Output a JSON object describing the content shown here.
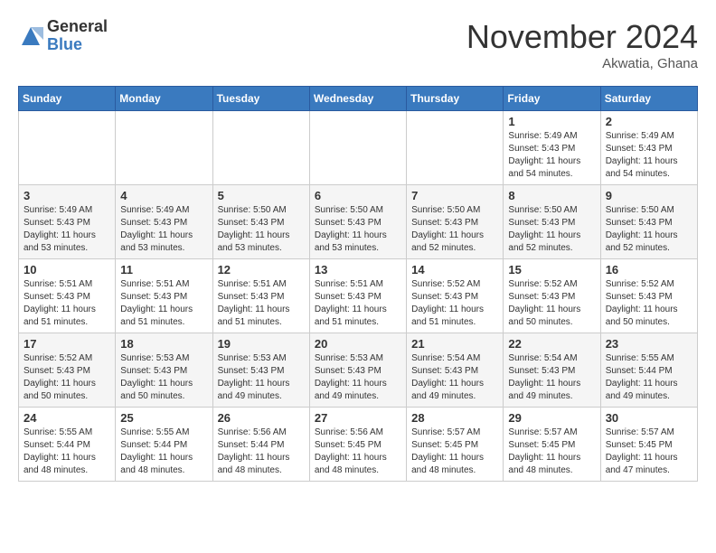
{
  "header": {
    "logo_general": "General",
    "logo_blue": "Blue",
    "month_title": "November 2024",
    "location": "Akwatia, Ghana"
  },
  "weekdays": [
    "Sunday",
    "Monday",
    "Tuesday",
    "Wednesday",
    "Thursday",
    "Friday",
    "Saturday"
  ],
  "weeks": [
    [
      {
        "day": "",
        "info": ""
      },
      {
        "day": "",
        "info": ""
      },
      {
        "day": "",
        "info": ""
      },
      {
        "day": "",
        "info": ""
      },
      {
        "day": "",
        "info": ""
      },
      {
        "day": "1",
        "info": "Sunrise: 5:49 AM\nSunset: 5:43 PM\nDaylight: 11 hours\nand 54 minutes."
      },
      {
        "day": "2",
        "info": "Sunrise: 5:49 AM\nSunset: 5:43 PM\nDaylight: 11 hours\nand 54 minutes."
      }
    ],
    [
      {
        "day": "3",
        "info": "Sunrise: 5:49 AM\nSunset: 5:43 PM\nDaylight: 11 hours\nand 53 minutes."
      },
      {
        "day": "4",
        "info": "Sunrise: 5:49 AM\nSunset: 5:43 PM\nDaylight: 11 hours\nand 53 minutes."
      },
      {
        "day": "5",
        "info": "Sunrise: 5:50 AM\nSunset: 5:43 PM\nDaylight: 11 hours\nand 53 minutes."
      },
      {
        "day": "6",
        "info": "Sunrise: 5:50 AM\nSunset: 5:43 PM\nDaylight: 11 hours\nand 53 minutes."
      },
      {
        "day": "7",
        "info": "Sunrise: 5:50 AM\nSunset: 5:43 PM\nDaylight: 11 hours\nand 52 minutes."
      },
      {
        "day": "8",
        "info": "Sunrise: 5:50 AM\nSunset: 5:43 PM\nDaylight: 11 hours\nand 52 minutes."
      },
      {
        "day": "9",
        "info": "Sunrise: 5:50 AM\nSunset: 5:43 PM\nDaylight: 11 hours\nand 52 minutes."
      }
    ],
    [
      {
        "day": "10",
        "info": "Sunrise: 5:51 AM\nSunset: 5:43 PM\nDaylight: 11 hours\nand 51 minutes."
      },
      {
        "day": "11",
        "info": "Sunrise: 5:51 AM\nSunset: 5:43 PM\nDaylight: 11 hours\nand 51 minutes."
      },
      {
        "day": "12",
        "info": "Sunrise: 5:51 AM\nSunset: 5:43 PM\nDaylight: 11 hours\nand 51 minutes."
      },
      {
        "day": "13",
        "info": "Sunrise: 5:51 AM\nSunset: 5:43 PM\nDaylight: 11 hours\nand 51 minutes."
      },
      {
        "day": "14",
        "info": "Sunrise: 5:52 AM\nSunset: 5:43 PM\nDaylight: 11 hours\nand 51 minutes."
      },
      {
        "day": "15",
        "info": "Sunrise: 5:52 AM\nSunset: 5:43 PM\nDaylight: 11 hours\nand 50 minutes."
      },
      {
        "day": "16",
        "info": "Sunrise: 5:52 AM\nSunset: 5:43 PM\nDaylight: 11 hours\nand 50 minutes."
      }
    ],
    [
      {
        "day": "17",
        "info": "Sunrise: 5:52 AM\nSunset: 5:43 PM\nDaylight: 11 hours\nand 50 minutes."
      },
      {
        "day": "18",
        "info": "Sunrise: 5:53 AM\nSunset: 5:43 PM\nDaylight: 11 hours\nand 50 minutes."
      },
      {
        "day": "19",
        "info": "Sunrise: 5:53 AM\nSunset: 5:43 PM\nDaylight: 11 hours\nand 49 minutes."
      },
      {
        "day": "20",
        "info": "Sunrise: 5:53 AM\nSunset: 5:43 PM\nDaylight: 11 hours\nand 49 minutes."
      },
      {
        "day": "21",
        "info": "Sunrise: 5:54 AM\nSunset: 5:43 PM\nDaylight: 11 hours\nand 49 minutes."
      },
      {
        "day": "22",
        "info": "Sunrise: 5:54 AM\nSunset: 5:43 PM\nDaylight: 11 hours\nand 49 minutes."
      },
      {
        "day": "23",
        "info": "Sunrise: 5:55 AM\nSunset: 5:44 PM\nDaylight: 11 hours\nand 49 minutes."
      }
    ],
    [
      {
        "day": "24",
        "info": "Sunrise: 5:55 AM\nSunset: 5:44 PM\nDaylight: 11 hours\nand 48 minutes."
      },
      {
        "day": "25",
        "info": "Sunrise: 5:55 AM\nSunset: 5:44 PM\nDaylight: 11 hours\nand 48 minutes."
      },
      {
        "day": "26",
        "info": "Sunrise: 5:56 AM\nSunset: 5:44 PM\nDaylight: 11 hours\nand 48 minutes."
      },
      {
        "day": "27",
        "info": "Sunrise: 5:56 AM\nSunset: 5:45 PM\nDaylight: 11 hours\nand 48 minutes."
      },
      {
        "day": "28",
        "info": "Sunrise: 5:57 AM\nSunset: 5:45 PM\nDaylight: 11 hours\nand 48 minutes."
      },
      {
        "day": "29",
        "info": "Sunrise: 5:57 AM\nSunset: 5:45 PM\nDaylight: 11 hours\nand 48 minutes."
      },
      {
        "day": "30",
        "info": "Sunrise: 5:57 AM\nSunset: 5:45 PM\nDaylight: 11 hours\nand 47 minutes."
      }
    ]
  ]
}
